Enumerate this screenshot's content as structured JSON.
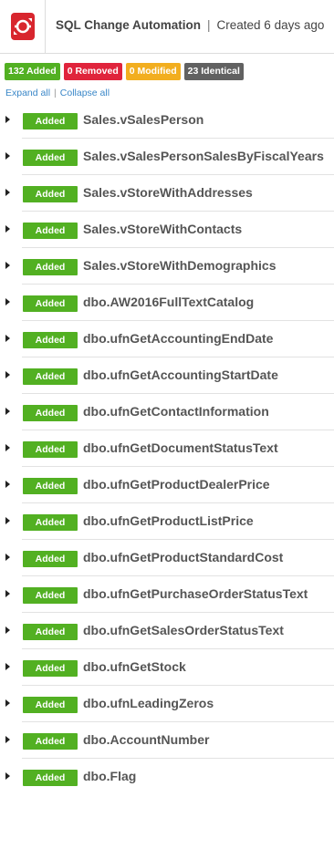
{
  "header": {
    "logo_icon": "sql-change-automation-logo-icon",
    "title": "SQL Change Automation",
    "separator": "|",
    "created": "Created 6 days ago"
  },
  "summary": {
    "added": "132 Added",
    "removed": "0 Removed",
    "modified": "0 Modified",
    "identical": "23 Identical",
    "colors": {
      "added": "#52b022",
      "removed": "#e0243c",
      "modified": "#f2ae1f",
      "identical": "#616161"
    }
  },
  "controls": {
    "expand_all": "Expand all",
    "separator": "|",
    "collapse_all": "Collapse all"
  },
  "objects": [
    {
      "status": "Added",
      "name": "Sales.vSalesPerson"
    },
    {
      "status": "Added",
      "name": "Sales.vSalesPersonSalesByFiscalYears"
    },
    {
      "status": "Added",
      "name": "Sales.vStoreWithAddresses"
    },
    {
      "status": "Added",
      "name": "Sales.vStoreWithContacts"
    },
    {
      "status": "Added",
      "name": "Sales.vStoreWithDemographics"
    },
    {
      "status": "Added",
      "name": "dbo.AW2016FullTextCatalog"
    },
    {
      "status": "Added",
      "name": "dbo.ufnGetAccountingEndDate"
    },
    {
      "status": "Added",
      "name": "dbo.ufnGetAccountingStartDate"
    },
    {
      "status": "Added",
      "name": "dbo.ufnGetContactInformation"
    },
    {
      "status": "Added",
      "name": "dbo.ufnGetDocumentStatusText"
    },
    {
      "status": "Added",
      "name": "dbo.ufnGetProductDealerPrice"
    },
    {
      "status": "Added",
      "name": "dbo.ufnGetProductListPrice"
    },
    {
      "status": "Added",
      "name": "dbo.ufnGetProductStandardCost"
    },
    {
      "status": "Added",
      "name": "dbo.ufnGetPurchaseOrderStatusText"
    },
    {
      "status": "Added",
      "name": "dbo.ufnGetSalesOrderStatusText"
    },
    {
      "status": "Added",
      "name": "dbo.ufnGetStock"
    },
    {
      "status": "Added",
      "name": "dbo.ufnLeadingZeros"
    },
    {
      "status": "Added",
      "name": "dbo.AccountNumber"
    },
    {
      "status": "Added",
      "name": "dbo.Flag"
    }
  ]
}
